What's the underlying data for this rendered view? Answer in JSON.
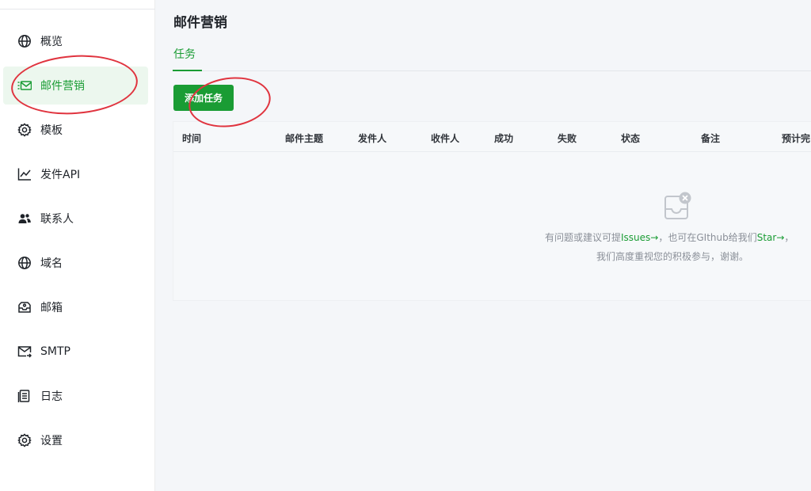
{
  "sidebar": {
    "items": [
      {
        "label": "概览",
        "icon": "globe-icon",
        "active": false
      },
      {
        "label": "邮件营销",
        "icon": "mail-marketing-icon",
        "active": true
      },
      {
        "label": "模板",
        "icon": "gear-icon",
        "active": false
      },
      {
        "label": "发件API",
        "icon": "chart-line-icon",
        "active": false
      },
      {
        "label": "联系人",
        "icon": "contacts-icon",
        "active": false
      },
      {
        "label": "域名",
        "icon": "globe-icon",
        "active": false
      },
      {
        "label": "邮箱",
        "icon": "mailbox-icon",
        "active": false
      },
      {
        "label": "SMTP",
        "icon": "mail-send-icon",
        "active": false
      },
      {
        "label": "日志",
        "icon": "document-icon",
        "active": false
      },
      {
        "label": "设置",
        "icon": "gear-icon",
        "active": false
      }
    ]
  },
  "main": {
    "title": "邮件营销",
    "tabs": [
      {
        "label": "任务",
        "active": true
      }
    ],
    "add_button_label": "添加任务",
    "table": {
      "columns": [
        "时间",
        "邮件主题",
        "发件人",
        "收件人",
        "成功",
        "失败",
        "状态",
        "备注",
        "预计完"
      ]
    },
    "empty": {
      "line1_prefix": "有问题或建议可提",
      "issues_link": "Issues→",
      "line1_middle": "，也可在GIthub给我们",
      "star_link": "Star→",
      "line1_suffix": "，",
      "line2": "我们高度重视您的积极参与，谢谢。"
    }
  },
  "colors": {
    "accent": "#1a9c34",
    "active_bg": "#ecf7ee",
    "annotation": "#e0343f"
  }
}
